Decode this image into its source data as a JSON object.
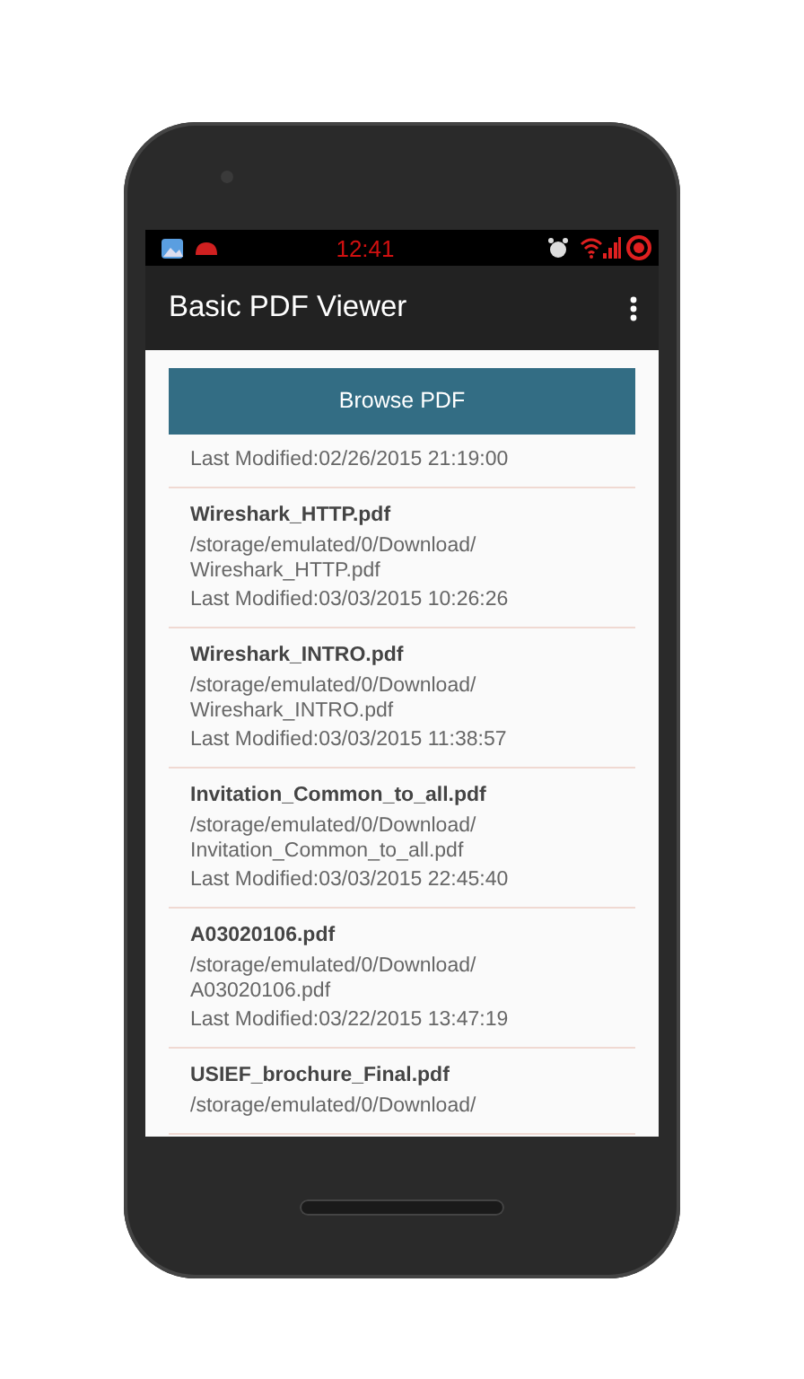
{
  "status_bar": {
    "time": "12:41"
  },
  "app_bar": {
    "title": "Basic PDF Viewer"
  },
  "browse_button": {
    "label": "Browse PDF"
  },
  "files": [
    {
      "modified": "Last Modified:02/26/2015 21:19:00"
    },
    {
      "name": "Wireshark_HTTP.pdf",
      "path": [
        "/storage/emulated/0/Download/",
        "Wireshark_HTTP.pdf"
      ],
      "modified": "Last Modified:03/03/2015 10:26:26"
    },
    {
      "name": "Wireshark_INTRO.pdf",
      "path": [
        "/storage/emulated/0/Download/",
        "Wireshark_INTRO.pdf"
      ],
      "modified": "Last Modified:03/03/2015 11:38:57"
    },
    {
      "name": "Invitation_Common_to_all.pdf",
      "path": [
        "/storage/emulated/0/Download/",
        "Invitation_Common_to_all.pdf"
      ],
      "modified": "Last Modified:03/03/2015 22:45:40"
    },
    {
      "name": "A03020106.pdf",
      "path": [
        "/storage/emulated/0/Download/",
        "A03020106.pdf"
      ],
      "modified": "Last Modified:03/22/2015 13:47:19"
    },
    {
      "name": "USIEF_brochure_Final.pdf",
      "path": [
        "/storage/emulated/0/Download/"
      ]
    }
  ]
}
